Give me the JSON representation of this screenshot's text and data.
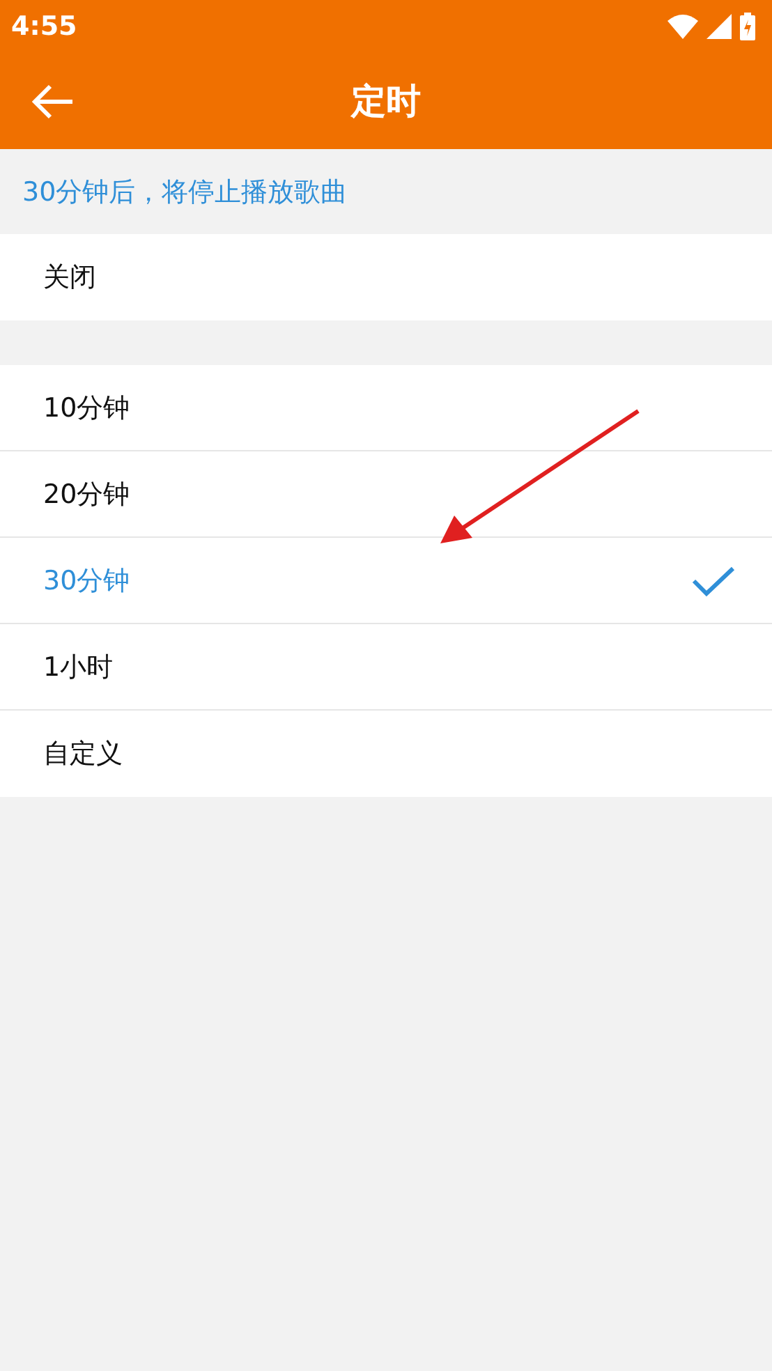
{
  "status_bar": {
    "time": "4:55"
  },
  "toolbar": {
    "title": "定时"
  },
  "info": "30分钟后，将停止播放歌曲",
  "off_option": {
    "label": "关闭",
    "selected": false
  },
  "options": [
    {
      "label": "10分钟",
      "selected": false
    },
    {
      "label": "20分钟",
      "selected": false
    },
    {
      "label": "30分钟",
      "selected": true
    },
    {
      "label": "1小时",
      "selected": false
    },
    {
      "label": "自定义",
      "selected": false
    }
  ]
}
